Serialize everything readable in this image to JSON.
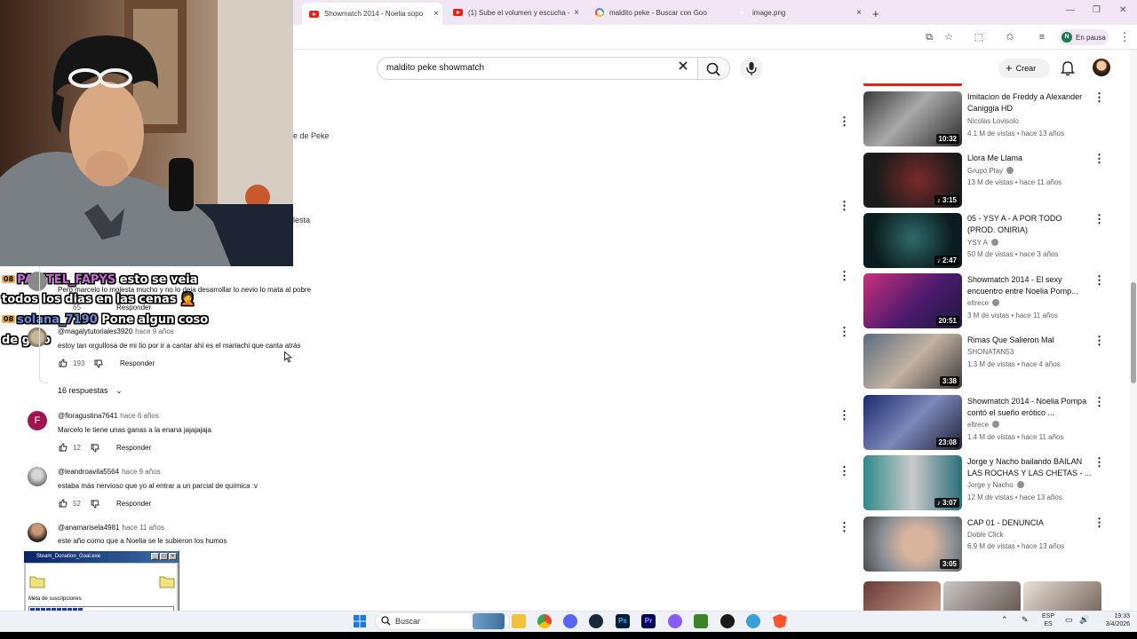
{
  "browser": {
    "tabs": [
      {
        "title": "Showmatch 2014 - Noelia sopo",
        "favicon": "youtube-icon",
        "active": true
      },
      {
        "title": "(1) Sube el volumen y escucha -",
        "favicon": "youtube-icon",
        "active": false
      },
      {
        "title": "maldito peke - Buscar con Goo",
        "favicon": "google-icon",
        "active": false
      },
      {
        "title": "image.png",
        "favicon": "blank",
        "active": false
      }
    ],
    "profile_label": "En pausa",
    "profile_initial": "N"
  },
  "youtube": {
    "search_value": "maldito peke showmatch",
    "create_label": "Crear"
  },
  "partial_text": {
    "line1": "e de Peke",
    "line2": "lesta"
  },
  "chat": {
    "lines": [
      {
        "badge": "08",
        "user": "PAPITEL_FAPYS",
        "message": " esto se veia"
      },
      {
        "badge": "",
        "user": "",
        "message": "todos los dias en las cenas 🤦"
      },
      {
        "badge": "08",
        "user": "solana_7190",
        "message": " Pone algun coso"
      },
      {
        "badge": "",
        "user": "",
        "message": "de gido"
      }
    ]
  },
  "comments": [
    {
      "handle": "",
      "time": "",
      "text": "Pero marcelo lo molesta mucho y no lo deja desarrollar lo nevio lo mata al pobre",
      "likes": "65",
      "reply": "Responder"
    },
    {
      "handle": "@magalytutoriales3920",
      "time": "hace 9 años",
      "text": "estoy tan orgullosa de mi tio por ir a cantar ahí es el mariachi que canta atrás",
      "likes": "193",
      "reply": "Responder"
    },
    {
      "handle": "@floragustina7641",
      "time": "hace 6 años",
      "text": "Marcelo le tiene unas ganas a la enana jajajajaja",
      "likes": "12",
      "reply": "Responder",
      "avatar_letter": "F"
    },
    {
      "handle": "@leandroavila5564",
      "time": "hace 9 años",
      "text": "estaba más nervioso que yo al entrar a un parcial de química :v",
      "likes": "52",
      "reply": "Responder"
    },
    {
      "handle": "@anamarisela4981",
      "time": "hace 11 años",
      "text": "este año como que a Noelia se le subieron los humos",
      "likes": "",
      "reply": ""
    }
  ],
  "replies_toggle": "16 respuestas",
  "sidebar_videos": [
    {
      "title": "Imitacion de Freddy a Alexander Caniggia HD",
      "channel": "Nicolas Lovisolo",
      "verified": false,
      "meta": "4.1 M de vistas • hace 13 años",
      "duration": "10:32",
      "short": false
    },
    {
      "title": "Llora Me Llama",
      "channel": "Grupo Play",
      "verified": true,
      "meta": "13 M de vistas • hace 11 años",
      "duration": "3:15",
      "short": true
    },
    {
      "title": "05 - YSY A - A POR TODO (PROD. ONIRIA)",
      "channel": "YSY A",
      "verified": true,
      "meta": "50 M de vistas • hace 3 años",
      "duration": "2:47",
      "short": true
    },
    {
      "title": "Showmatch 2014 - El sexy encuentro entre Noelia Pomp...",
      "channel": "eltrece",
      "verified": true,
      "meta": "3 M de vistas • hace 11 años",
      "duration": "20:51",
      "short": false
    },
    {
      "title": "Rimas Que Salieron Mal",
      "channel": "SHONATAN53",
      "verified": false,
      "meta": "1.3 M de vistas • hace 4 años",
      "duration": "3:38",
      "short": false
    },
    {
      "title": "Showmatch 2014 - Noelia Pompa contó el sueño erótico ...",
      "channel": "eltrece",
      "verified": true,
      "meta": "1.4 M de vistas • hace 11 años",
      "duration": "23:08",
      "short": false
    },
    {
      "title": "Jorge y Nacho bailando BAILAN LAS ROCHAS Y LAS CHETAS - ...",
      "channel": "Jorge y Nacho",
      "verified": true,
      "meta": "12 M de vistas • hace 13 años",
      "duration": "3:07",
      "short": true
    },
    {
      "title": "CAP 01 - DENUNCIA",
      "channel": "Doble Click",
      "verified": false,
      "meta": "6.9 M de vistas • hace 13 años",
      "duration": "3:05",
      "short": false
    }
  ],
  "donation_widget": {
    "title": "Steam_Donation_Goal.exe",
    "label": "Meta de suscripciones",
    "progress": 0.6
  },
  "taskbar": {
    "search_placeholder": "Buscar",
    "lang_top": "ESP",
    "lang_bottom": "ES",
    "time": "19:33",
    "date": "3/4/2026"
  },
  "colors": {
    "accent_youtube": "#e62117",
    "chat_user": "#c86bd6",
    "donation_bar": "#1a3ea8"
  }
}
